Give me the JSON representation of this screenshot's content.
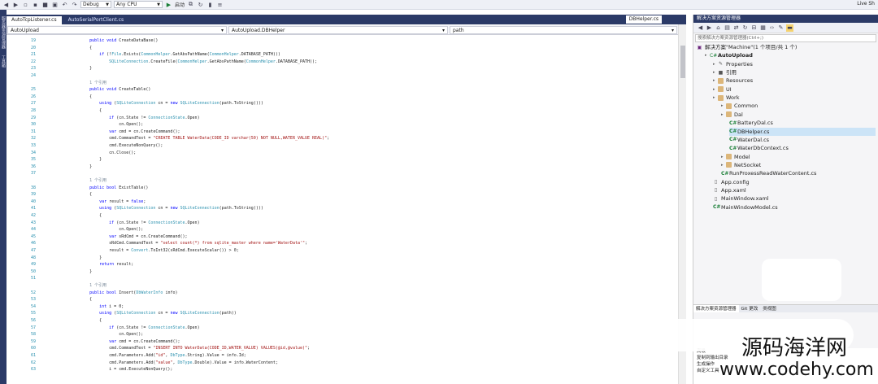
{
  "toolbar": {
    "config": "Debug",
    "platform": "Any CPU",
    "start": "启动",
    "live_share": "Live Sh"
  },
  "tabs": [
    {
      "label": "AutoTcpListener.cs",
      "active": true
    },
    {
      "label": "AutoSerialPortClient.cs",
      "active": false
    }
  ],
  "tab_right": "DBHelper.cs",
  "navbar": {
    "project": "AutoUpload",
    "class": "AutoUpload.DBHelper",
    "member": "path"
  },
  "code_lines": [
    {
      "n": "19",
      "t": "        public void CreateDataBase()"
    },
    {
      "n": "20",
      "t": "        {"
    },
    {
      "n": "21",
      "t": "            if (!File.Exists(CommonHelper.GetAbsPathName(CommonHelper.DATABASE_PATH)))"
    },
    {
      "n": "22",
      "t": "                SQLiteConnection.CreateFile(CommonHelper.GetAbsPathName(CommonHelper.DATABASE_PATH));"
    },
    {
      "n": "23",
      "t": "        }"
    },
    {
      "n": "24",
      "t": ""
    },
    {
      "n": "",
      "t": "        1 个引用",
      "c": true
    },
    {
      "n": "25",
      "t": "        public void CreateTable()"
    },
    {
      "n": "26",
      "t": "        {"
    },
    {
      "n": "27",
      "t": "            using (SQLiteConnection cn = new SQLiteConnection(path.ToString()))"
    },
    {
      "n": "28",
      "t": "            {"
    },
    {
      "n": "29",
      "t": "                if (cn.State != ConnectionState.Open)"
    },
    {
      "n": "30",
      "t": "                    cn.Open();"
    },
    {
      "n": "31",
      "t": "                var cmd = cn.CreateCommand();"
    },
    {
      "n": "32",
      "t": "                cmd.CommandText = \"CREATE TABLE WaterData(CODE_ID varchar(50) NOT NULL,WATER_VALUE REAL)\";"
    },
    {
      "n": "33",
      "t": "                cmd.ExecuteNonQuery();"
    },
    {
      "n": "34",
      "t": "                cn.Close();"
    },
    {
      "n": "35",
      "t": "            }"
    },
    {
      "n": "36",
      "t": "        }"
    },
    {
      "n": "37",
      "t": ""
    },
    {
      "n": "",
      "t": "        1 个引用",
      "c": true
    },
    {
      "n": "38",
      "t": "        public bool ExistTable()"
    },
    {
      "n": "39",
      "t": "        {"
    },
    {
      "n": "40",
      "t": "            var result = false;"
    },
    {
      "n": "41",
      "t": "            using (SQLiteConnection cn = new SQLiteConnection(path.ToString()))"
    },
    {
      "n": "42",
      "t": "            {"
    },
    {
      "n": "43",
      "t": "                if (cn.State != ConnectionState.Open)"
    },
    {
      "n": "44",
      "t": "                    cn.Open();"
    },
    {
      "n": "45",
      "t": "                var sRdCmd = cn.CreateCommand();"
    },
    {
      "n": "46",
      "t": "                sRdCmd.CommandText = \"select count(*) from sqlite_master where name='WaterData'\";"
    },
    {
      "n": "47",
      "t": "                result = Convert.ToInt32(sRdCmd.ExecuteScalar()) > 0;"
    },
    {
      "n": "48",
      "t": "            }"
    },
    {
      "n": "49",
      "t": "            return result;"
    },
    {
      "n": "50",
      "t": "        }"
    },
    {
      "n": "51",
      "t": ""
    },
    {
      "n": "",
      "t": "        1 个引用",
      "c": true
    },
    {
      "n": "52",
      "t": "        public bool Insert(DbWaterInfo info)"
    },
    {
      "n": "53",
      "t": "        {"
    },
    {
      "n": "54",
      "t": "            int i = 0;"
    },
    {
      "n": "55",
      "t": "            using (SQLiteConnection cn = new SQLiteConnection(path))"
    },
    {
      "n": "56",
      "t": "            {"
    },
    {
      "n": "57",
      "t": "                if (cn.State != ConnectionState.Open)"
    },
    {
      "n": "58",
      "t": "                    cn.Open();"
    },
    {
      "n": "59",
      "t": "                var cmd = cn.CreateCommand();"
    },
    {
      "n": "60",
      "t": "                cmd.CommandText = \"INSERT INTO WaterData(CODE_ID,WATER_VALUE) VALUES(@id,@value)\";"
    },
    {
      "n": "61",
      "t": "                cmd.Parameters.Add(\"id\", DbType.String).Value = info.Id;"
    },
    {
      "n": "62",
      "t": "                cmd.Parameters.Add(\"value\", DbType.Double).Value = info.WaterContent;"
    },
    {
      "n": "63",
      "t": "                i = cmd.ExecuteNonQuery();"
    }
  ],
  "solution": {
    "title": "解决方案资源管理器",
    "search": "搜索解决方案资源管理器(Ctrl+;)",
    "nodes": [
      {
        "label": "解决方案\"Machine\"(1 个项目/共 1 个)",
        "lvl": 0,
        "ico": "sln"
      },
      {
        "label": "AutoUpload",
        "lvl": 1,
        "ico": "proj",
        "bold": true
      },
      {
        "label": "Properties",
        "lvl": 2,
        "ico": "wrench"
      },
      {
        "label": "引用",
        "lvl": 2,
        "ico": "ref"
      },
      {
        "label": "Resources",
        "lvl": 2,
        "ico": "folder"
      },
      {
        "label": "UI",
        "lvl": 2,
        "ico": "folder"
      },
      {
        "label": "Work",
        "lvl": 2,
        "ico": "folder"
      },
      {
        "label": "Common",
        "lvl": 3,
        "ico": "folder"
      },
      {
        "label": "Dal",
        "lvl": 3,
        "ico": "folder"
      },
      {
        "label": "BatteryDal.cs",
        "lvl": 4,
        "ico": "cs"
      },
      {
        "label": "DBHelper.cs",
        "lvl": 4,
        "ico": "cs",
        "sel": true
      },
      {
        "label": "WaterDal.cs",
        "lvl": 4,
        "ico": "cs"
      },
      {
        "label": "WaterDbContext.cs",
        "lvl": 4,
        "ico": "cs"
      },
      {
        "label": "Model",
        "lvl": 3,
        "ico": "folder"
      },
      {
        "label": "NetSocket",
        "lvl": 3,
        "ico": "folder"
      },
      {
        "label": "RunProxessReadWaterContent.cs",
        "lvl": 3,
        "ico": "cs"
      },
      {
        "label": "App.config",
        "lvl": 2,
        "ico": "file"
      },
      {
        "label": "App.xaml",
        "lvl": 2,
        "ico": "file"
      },
      {
        "label": "MainWindow.xaml",
        "lvl": 2,
        "ico": "file"
      },
      {
        "label": "MainWindowModel.cs",
        "lvl": 2,
        "ico": "cs"
      }
    ],
    "bottom_tabs": [
      "解决方案资源管理器",
      "Git 更改",
      "类视图"
    ],
    "props": [
      "高级",
      "复制到输出目录",
      "生成操作",
      "自定义工具"
    ]
  },
  "watermark": {
    "line1": "源码海洋网",
    "line2": "www.codehy.com"
  }
}
